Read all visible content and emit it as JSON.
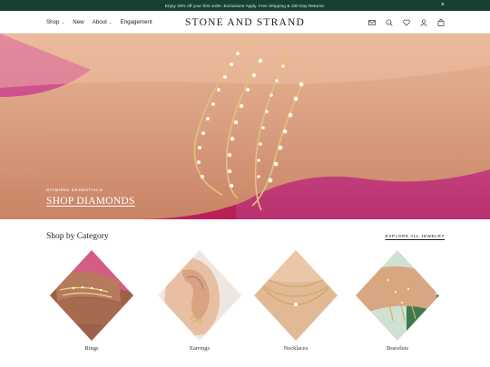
{
  "promo": {
    "text": "Enjoy 20% off your first order. Exclusions Apply. Free Shipping & 100 Day Returns.",
    "close_label": "×"
  },
  "nav": {
    "brand": "STONE AND STRAND",
    "items": [
      {
        "label": "Shop",
        "has_dropdown": true
      },
      {
        "label": "New",
        "has_dropdown": false
      },
      {
        "label": "About",
        "has_dropdown": true
      },
      {
        "label": "Engagement",
        "has_dropdown": false
      }
    ],
    "icons": [
      "mail-icon",
      "search-icon",
      "heart-icon",
      "account-icon",
      "bag-icon"
    ]
  },
  "hero": {
    "eyebrow": "DIAMOND ESSENTIALS",
    "cta": "SHOP DIAMONDS"
  },
  "categories": {
    "title": "Shop by Category",
    "explore": "EXPLORE ALL JEWELRY",
    "items": [
      {
        "label": "Rings"
      },
      {
        "label": "Earrings"
      },
      {
        "label": "Necklaces"
      },
      {
        "label": "Bracelets"
      }
    ]
  },
  "colors": {
    "promo_bg": "#173f33",
    "hero_bg": "#c74a87"
  }
}
